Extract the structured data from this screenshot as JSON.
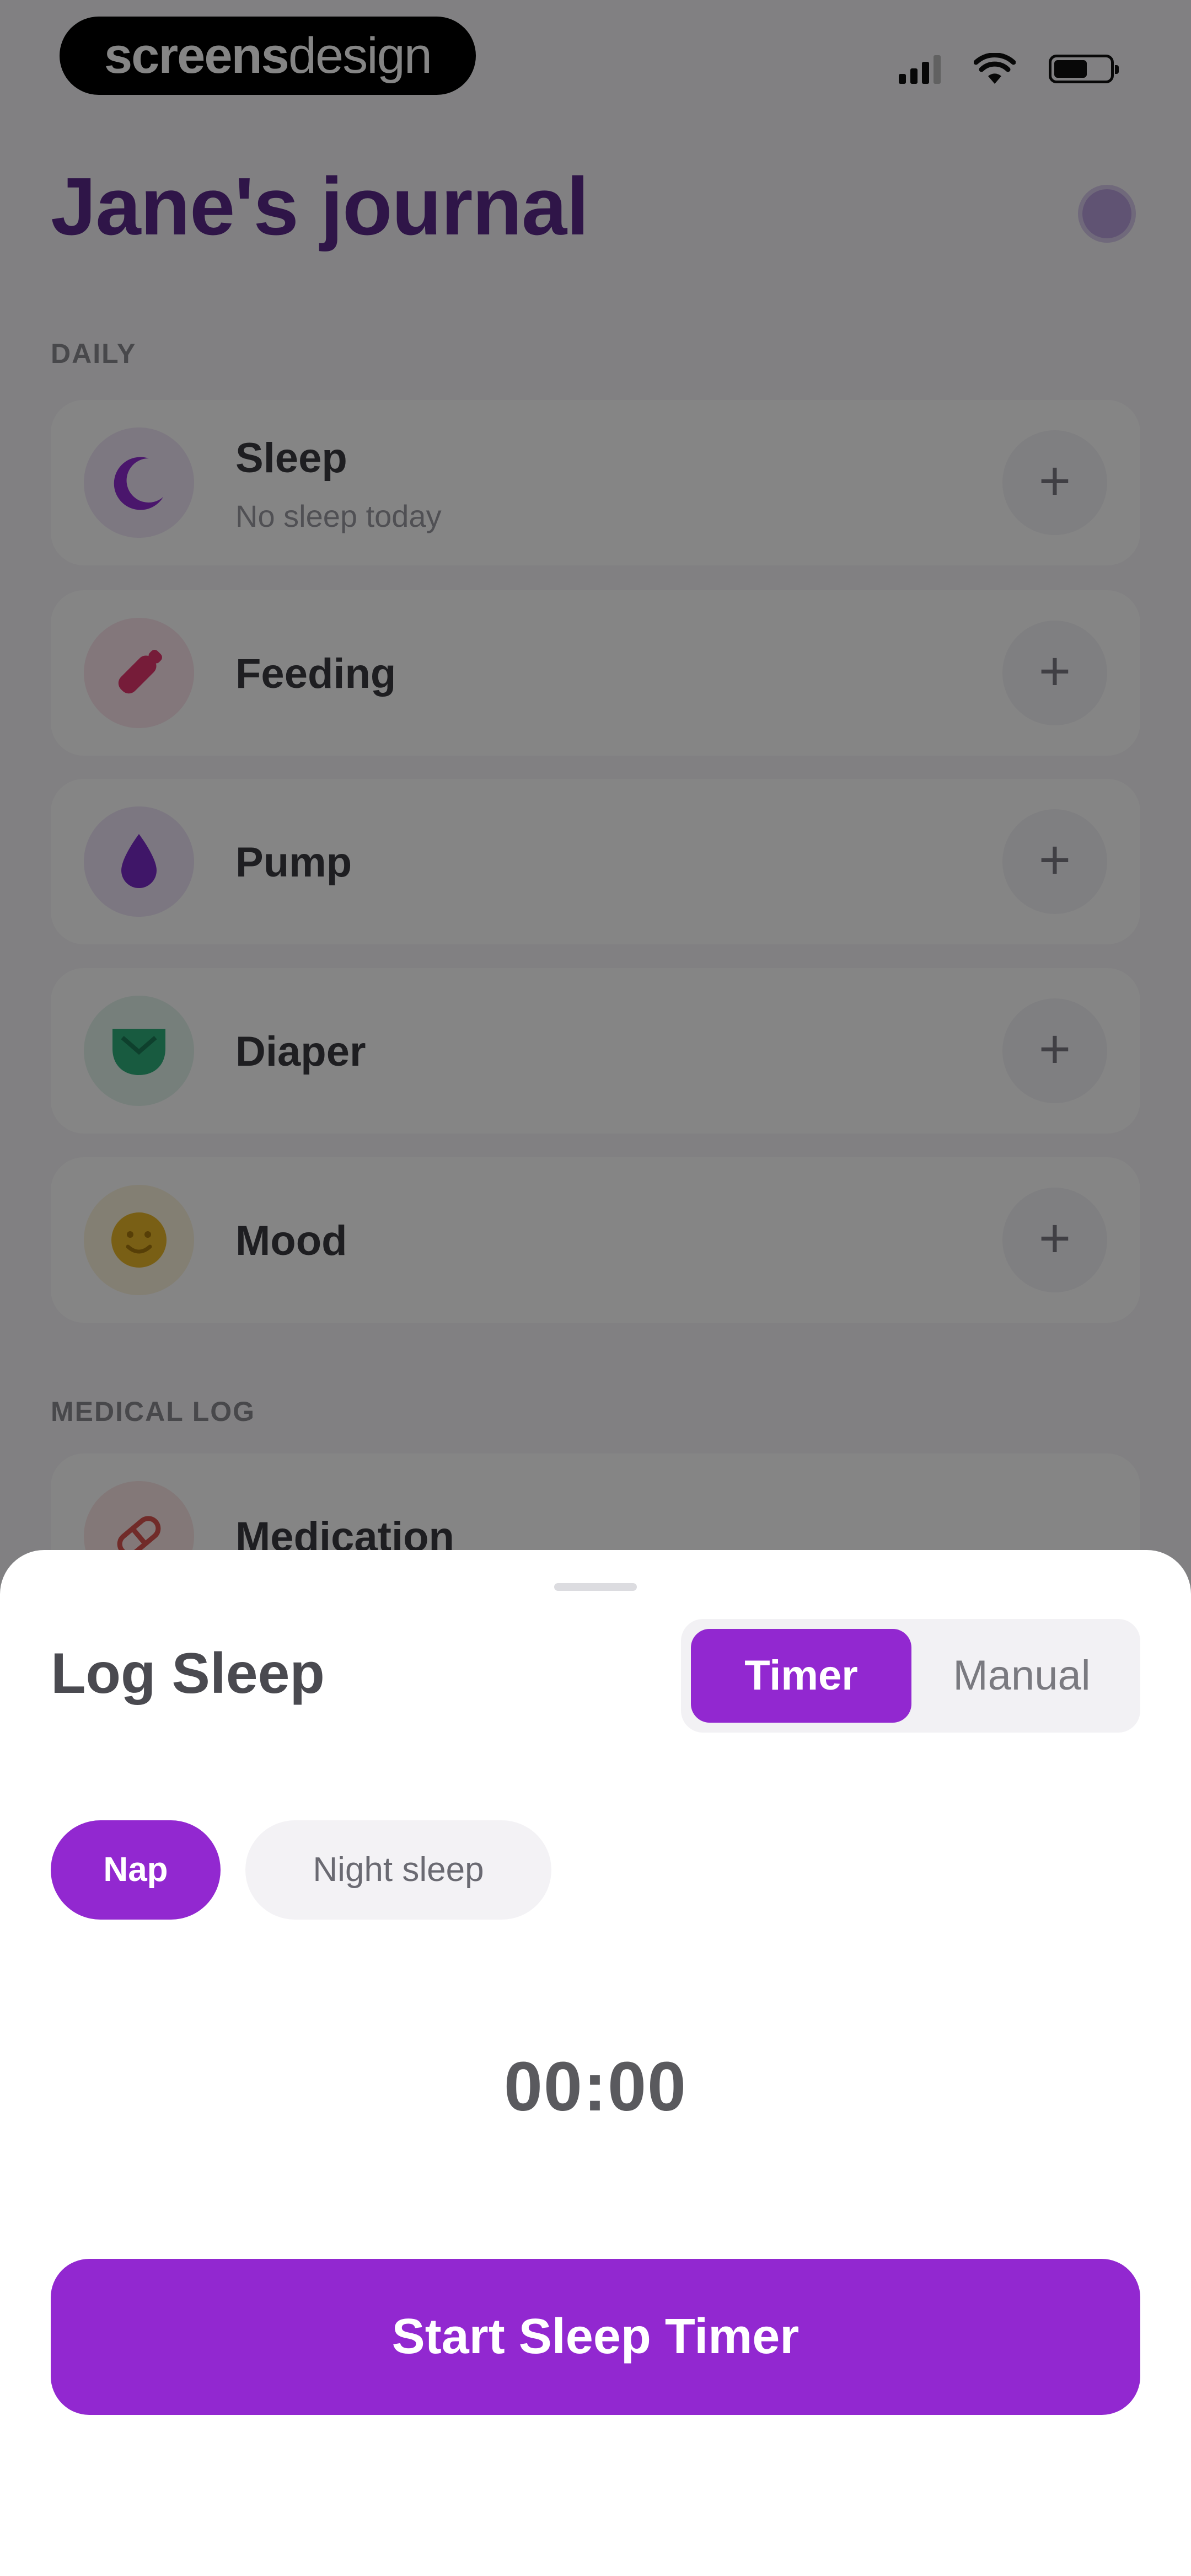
{
  "brand": {
    "part1": "screens",
    "part2": "design"
  },
  "header": {
    "title": "Jane's journal"
  },
  "sections": {
    "daily": "DAILY",
    "medical": "MEDICAL LOG"
  },
  "daily_items": [
    {
      "label": "Sleep",
      "subtitle": "No sleep today",
      "icon": "moon-icon"
    },
    {
      "label": "Feeding",
      "icon": "bottle-icon"
    },
    {
      "label": "Pump",
      "icon": "drop-icon"
    },
    {
      "label": "Diaper",
      "icon": "diaper-icon"
    },
    {
      "label": "Mood",
      "icon": "smiley-icon"
    }
  ],
  "medical_items": [
    {
      "label": "Medication",
      "icon": "pill-icon"
    }
  ],
  "add_symbol": "+",
  "sheet": {
    "title": "Log Sleep",
    "mode_options": [
      "Timer",
      "Manual"
    ],
    "mode_selected": "Timer",
    "type_options": [
      "Nap",
      "Night sleep"
    ],
    "type_selected": "Nap",
    "timer_value": "00:00",
    "cta_label": "Start Sleep Timer"
  },
  "colors": {
    "accent": "#9228d0",
    "title": "#5a2a8a",
    "sleep": "#8e2bd0",
    "feeding": "#e3366e",
    "pump": "#7a2bc7",
    "diaper": "#2fae7c",
    "mood": "#e8b72a",
    "medication": "#d9534f"
  }
}
